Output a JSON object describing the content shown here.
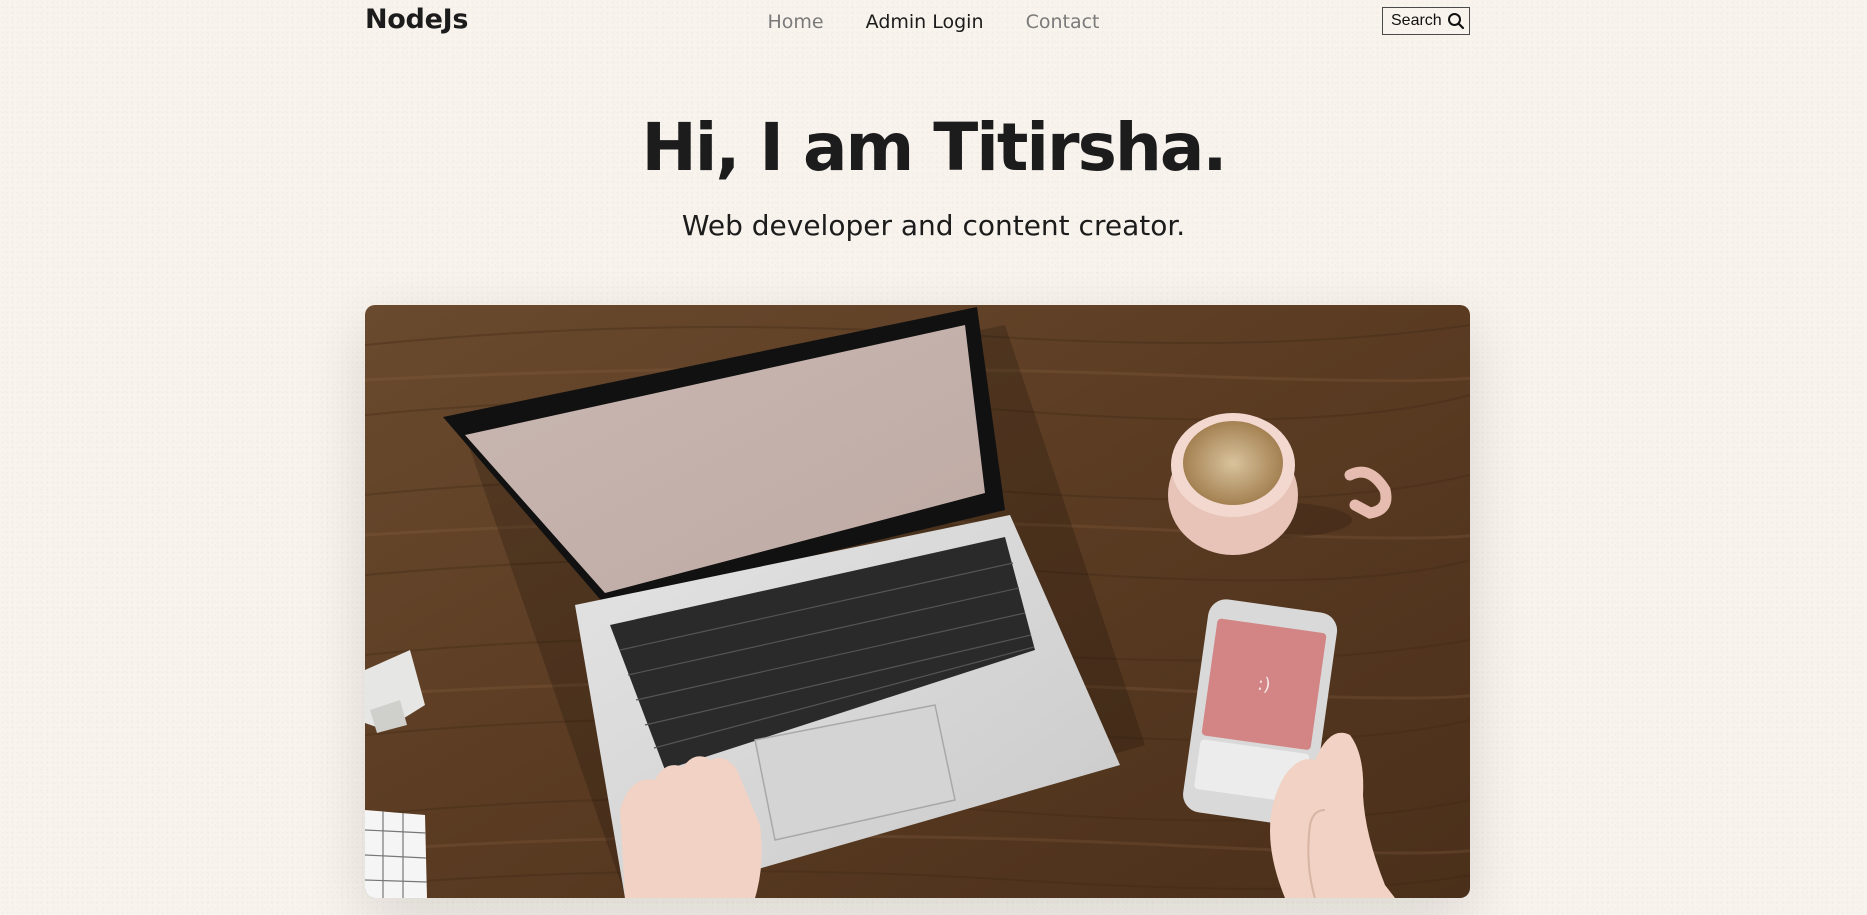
{
  "header": {
    "logo": "NodeJs",
    "nav": [
      {
        "label": "Home",
        "active": false
      },
      {
        "label": "Admin Login",
        "active": true
      },
      {
        "label": "Contact",
        "active": false
      }
    ],
    "search": {
      "label": "Search",
      "icon": "search-icon"
    }
  },
  "hero": {
    "title": "Hi, I am Titirsha.",
    "subtitle": "Web developer and content creator.",
    "image": {
      "phone_screen_text": ":)"
    }
  },
  "colors": {
    "background": "#f8f3ed",
    "text": "#1c1c1c",
    "nav_inactive": "#7a7a7a"
  }
}
